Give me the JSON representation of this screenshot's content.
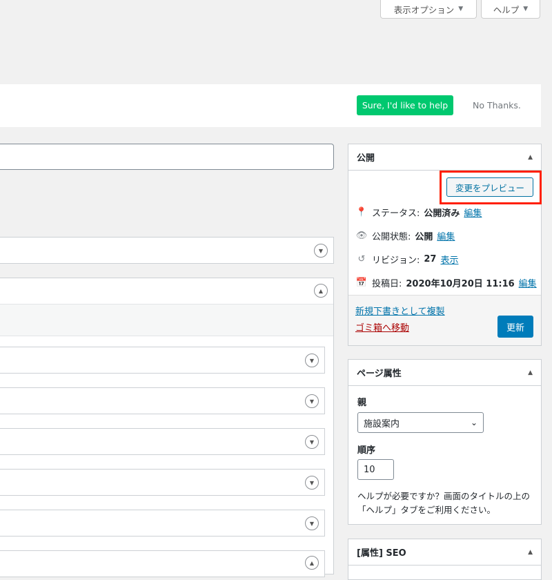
{
  "screen_meta": {
    "screen_options": "表示オプション",
    "help": "ヘルプ"
  },
  "notice": {
    "accept": "Sure, I'd like to help",
    "decline": "No Thanks."
  },
  "publish_box": {
    "title": "公開",
    "preview_button": "変更をプレビュー",
    "status_label": "ステータス:",
    "status_value": "公開済み",
    "visibility_label": "公開状態:",
    "visibility_value": "公開",
    "revisions_label": "リビジョン:",
    "revisions_value": "27",
    "revisions_link": "表示",
    "published_label": "投稿日:",
    "published_value": "2020年10月20日 11:16",
    "edit_link": "編集",
    "duplicate_link": "新規下書きとして複製",
    "trash_link": "ゴミ箱へ移動",
    "update_button": "更新"
  },
  "page_attributes": {
    "title": "ページ属性",
    "parent_label": "親",
    "parent_value": "施設案内",
    "order_label": "順序",
    "order_value": "10",
    "help_text": "ヘルプが必要ですか？画面のタイトルの上の「ヘルプ」タブをご利用ください。"
  },
  "seo_box": {
    "title": "[属性] SEO"
  }
}
